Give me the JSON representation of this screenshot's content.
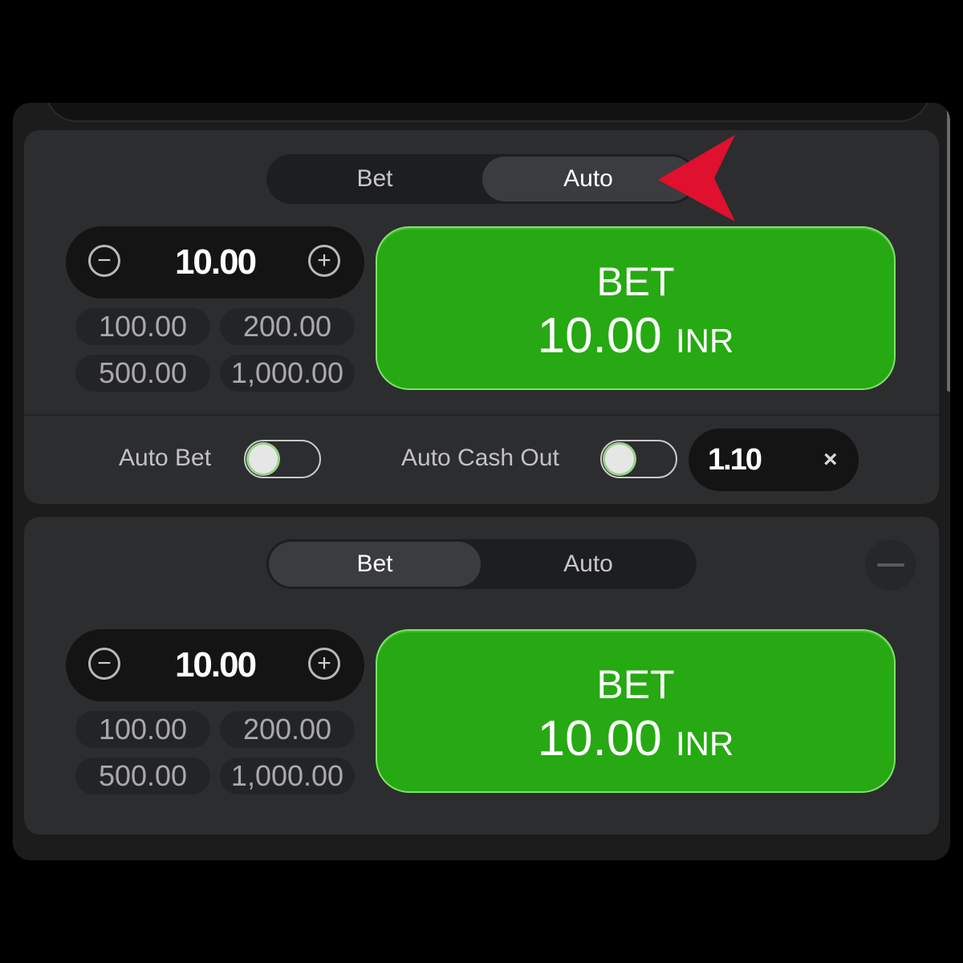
{
  "panel1": {
    "tabs": {
      "bet": "Bet",
      "auto": "Auto",
      "active": "auto"
    },
    "amount": "10.00",
    "quick_amounts": [
      "100.00",
      "200.00",
      "500.00",
      "1,000.00"
    ],
    "bet_button": {
      "line1": "BET",
      "amount": "10.00",
      "currency": "INR"
    },
    "auto_bet": {
      "label": "Auto Bet",
      "on": false
    },
    "auto_cash_out": {
      "label": "Auto Cash Out",
      "on": false,
      "multiplier": "1.10"
    },
    "clear_symbol": "×"
  },
  "panel2": {
    "tabs": {
      "bet": "Bet",
      "auto": "Auto",
      "active": "bet"
    },
    "amount": "10.00",
    "quick_amounts": [
      "100.00",
      "200.00",
      "500.00",
      "1,000.00"
    ],
    "bet_button": {
      "line1": "BET",
      "amount": "10.00",
      "currency": "INR"
    }
  },
  "icons": {
    "minus": "−",
    "plus": "+"
  },
  "colors": {
    "accent_green": "#26a912",
    "annotation_arrow": "#e0102f",
    "panel_bg": "#2c2d2f"
  }
}
